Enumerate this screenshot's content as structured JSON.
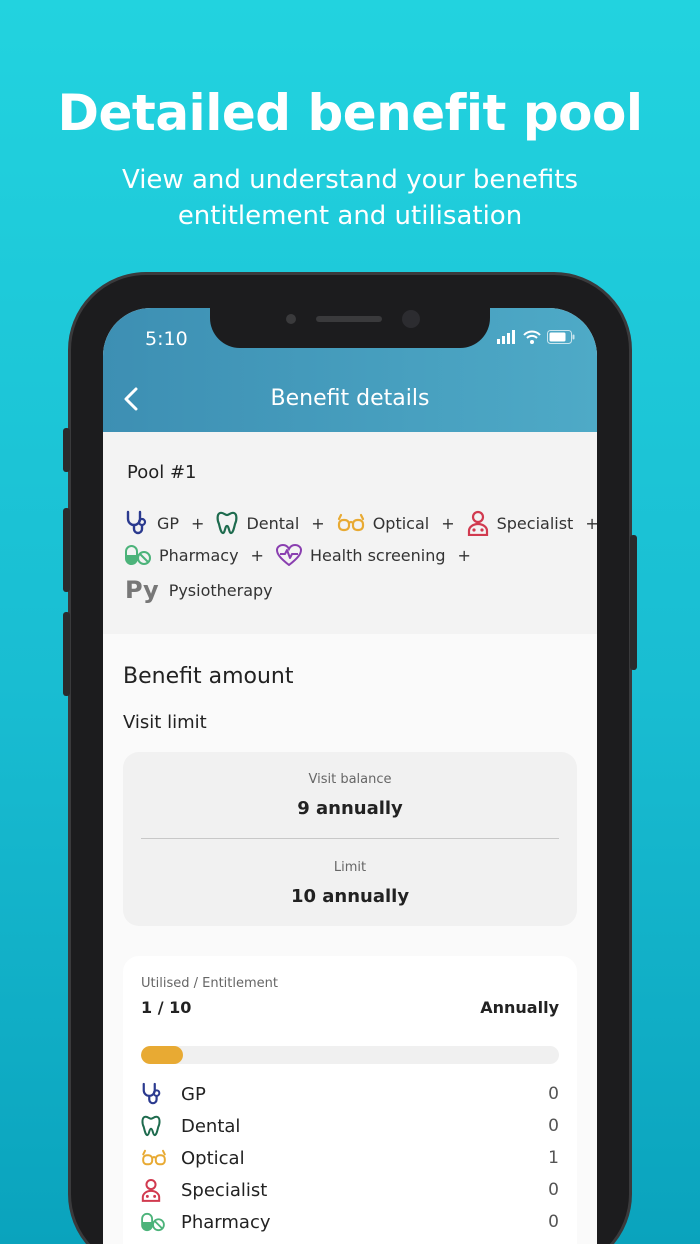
{
  "promo": {
    "headline": "Detailed benefit pool",
    "subline": "View and understand your benefits entitlement and utilisation"
  },
  "status_bar": {
    "time": "5:10"
  },
  "header": {
    "title": "Benefit details",
    "back_icon": "chevron-left-icon"
  },
  "pool": {
    "title": "Pool #1",
    "plus": "+",
    "items": [
      {
        "label": "GP",
        "icon": "stethoscope-icon"
      },
      {
        "label": "Dental",
        "icon": "tooth-icon"
      },
      {
        "label": "Optical",
        "icon": "glasses-icon"
      },
      {
        "label": "Specialist",
        "icon": "doctor-icon"
      },
      {
        "label": "Pharmacy",
        "icon": "pill-icon"
      },
      {
        "label": "Health screening",
        "icon": "heart-pulse-icon"
      },
      {
        "label": "Pysiotherapy",
        "icon": "py-icon",
        "icon_text": "Py"
      }
    ]
  },
  "benefit": {
    "heading": "Benefit amount",
    "visit_limit_label": "Visit limit",
    "balance_label": "Visit balance",
    "balance_value": "9 annually",
    "limit_label": "Limit",
    "limit_value": "10 annually"
  },
  "utilisation": {
    "label": "Utilised / Entitlement",
    "ratio": "1 / 10",
    "period": "Annually",
    "progress_fraction": 0.1,
    "rows": [
      {
        "label": "GP",
        "count": "0",
        "icon": "stethoscope-icon"
      },
      {
        "label": "Dental",
        "count": "0",
        "icon": "tooth-icon"
      },
      {
        "label": "Optical",
        "count": "1",
        "icon": "glasses-icon"
      },
      {
        "label": "Specialist",
        "count": "0",
        "icon": "doctor-icon"
      },
      {
        "label": "Pharmacy",
        "count": "0",
        "icon": "pill-icon"
      }
    ]
  },
  "colors": {
    "background": "#22d3df",
    "header": "#4a9fc0",
    "progress": "#e8aa33",
    "gp": "#2b3a8f",
    "dental": "#1e6b4e",
    "optical": "#e8aa33",
    "specialist": "#d13a4f",
    "pharmacy": "#4cb37a",
    "screening": "#8a3fb0"
  }
}
